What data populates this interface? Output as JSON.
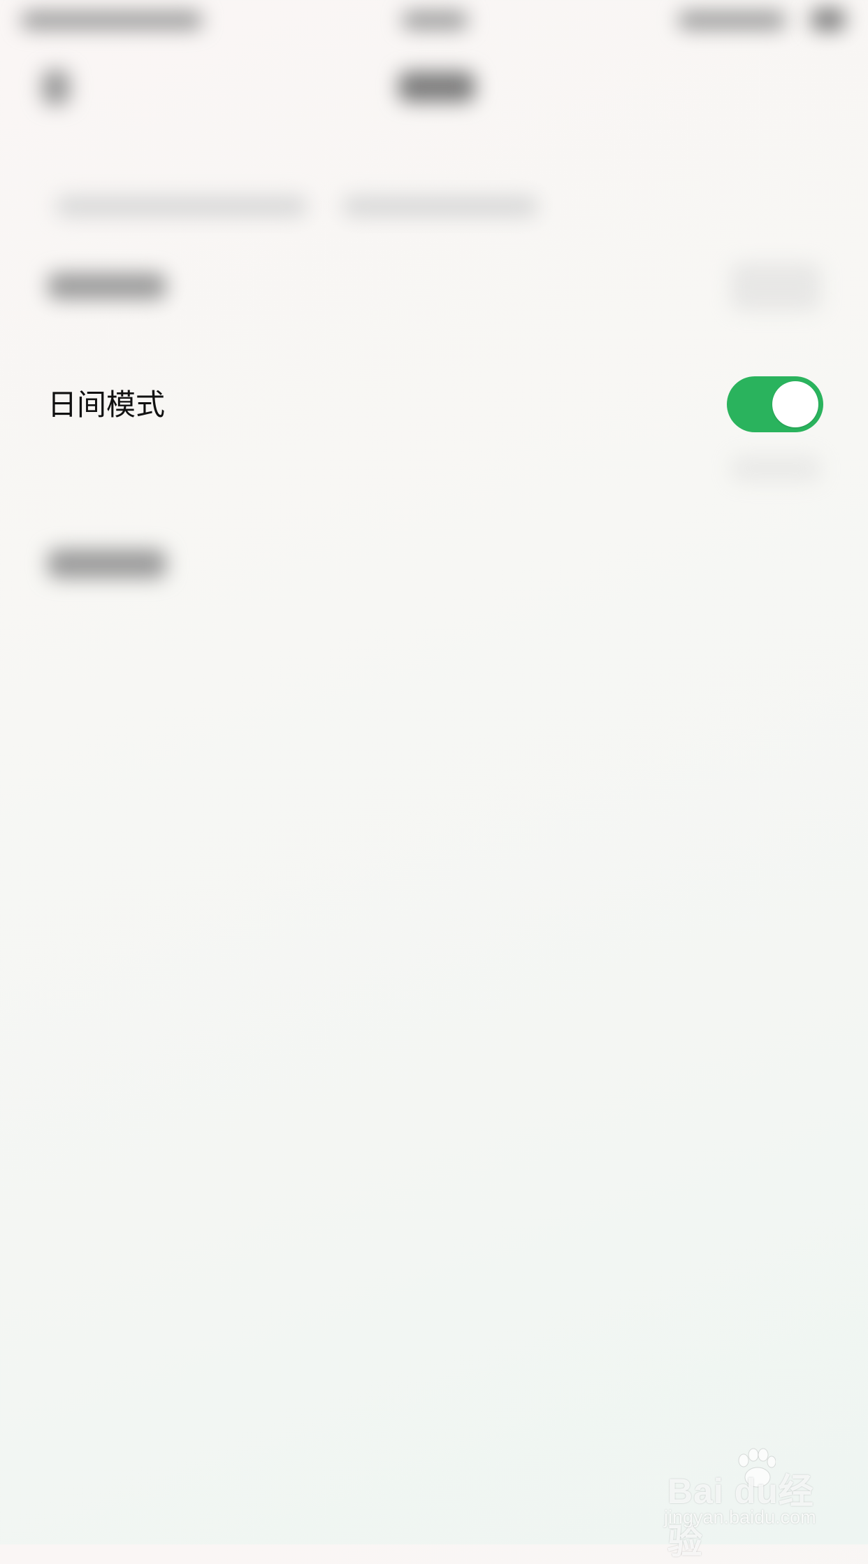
{
  "settings": {
    "day_mode": {
      "label": "日间模式",
      "enabled": true,
      "accent_color": "#2ab35d"
    }
  },
  "watermark": {
    "brand": "Bai du经验",
    "url": "jingyan.baidu.com"
  },
  "icons": {
    "status_bar": "blurred-status-icons",
    "back": "back-arrow-icon",
    "watermark": "baidu-paw-icon"
  }
}
